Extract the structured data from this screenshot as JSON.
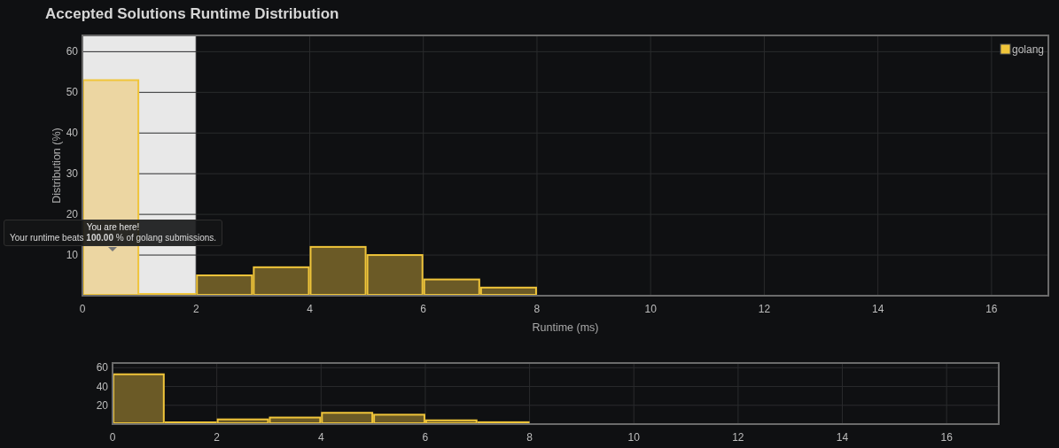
{
  "title": "Accepted Solutions Runtime Distribution",
  "main_chart": {
    "tooltip": {
      "title": "You are here!",
      "text": "Your runtime beats **100.00** % of golang submissions."
    },
    "chart_data": {
      "type": "bar",
      "xlabel": "Runtime (ms)",
      "ylabel": "Distribution (%)",
      "x": [
        0.5,
        1.5,
        2.5,
        3.5,
        4.5,
        5.5,
        6.5,
        7.5
      ],
      "series": [
        {
          "name": "golang",
          "color": "#f0c53a",
          "values": [
            53,
            0,
            5,
            7,
            12,
            10,
            4,
            2
          ]
        }
      ],
      "xlim": [
        0,
        17
      ],
      "ylim": [
        0,
        64
      ],
      "xticks": [
        0,
        2,
        4,
        6,
        8,
        10,
        12,
        14,
        16
      ],
      "yticks": [
        10,
        20,
        30,
        40,
        50,
        60
      ],
      "grid": true,
      "bands": [
        {
          "axis": "x",
          "from": 0,
          "to": 2
        }
      ]
    }
  },
  "overview_chart": {
    "chart_data": {
      "type": "bar",
      "x": [
        0.5,
        1.5,
        2.5,
        3.5,
        4.5,
        5.5,
        6.5,
        7.5
      ],
      "series": [
        {
          "color": "#f0c53a",
          "values": [
            53,
            0,
            5,
            7,
            12,
            10,
            4,
            2
          ]
        }
      ],
      "xlim": [
        0,
        17
      ],
      "ylim": [
        0,
        65
      ],
      "xticks": [
        0,
        2,
        4,
        6,
        8,
        10,
        12,
        14,
        16
      ],
      "yticks": [
        20,
        40,
        60
      ],
      "grid": true
    }
  }
}
